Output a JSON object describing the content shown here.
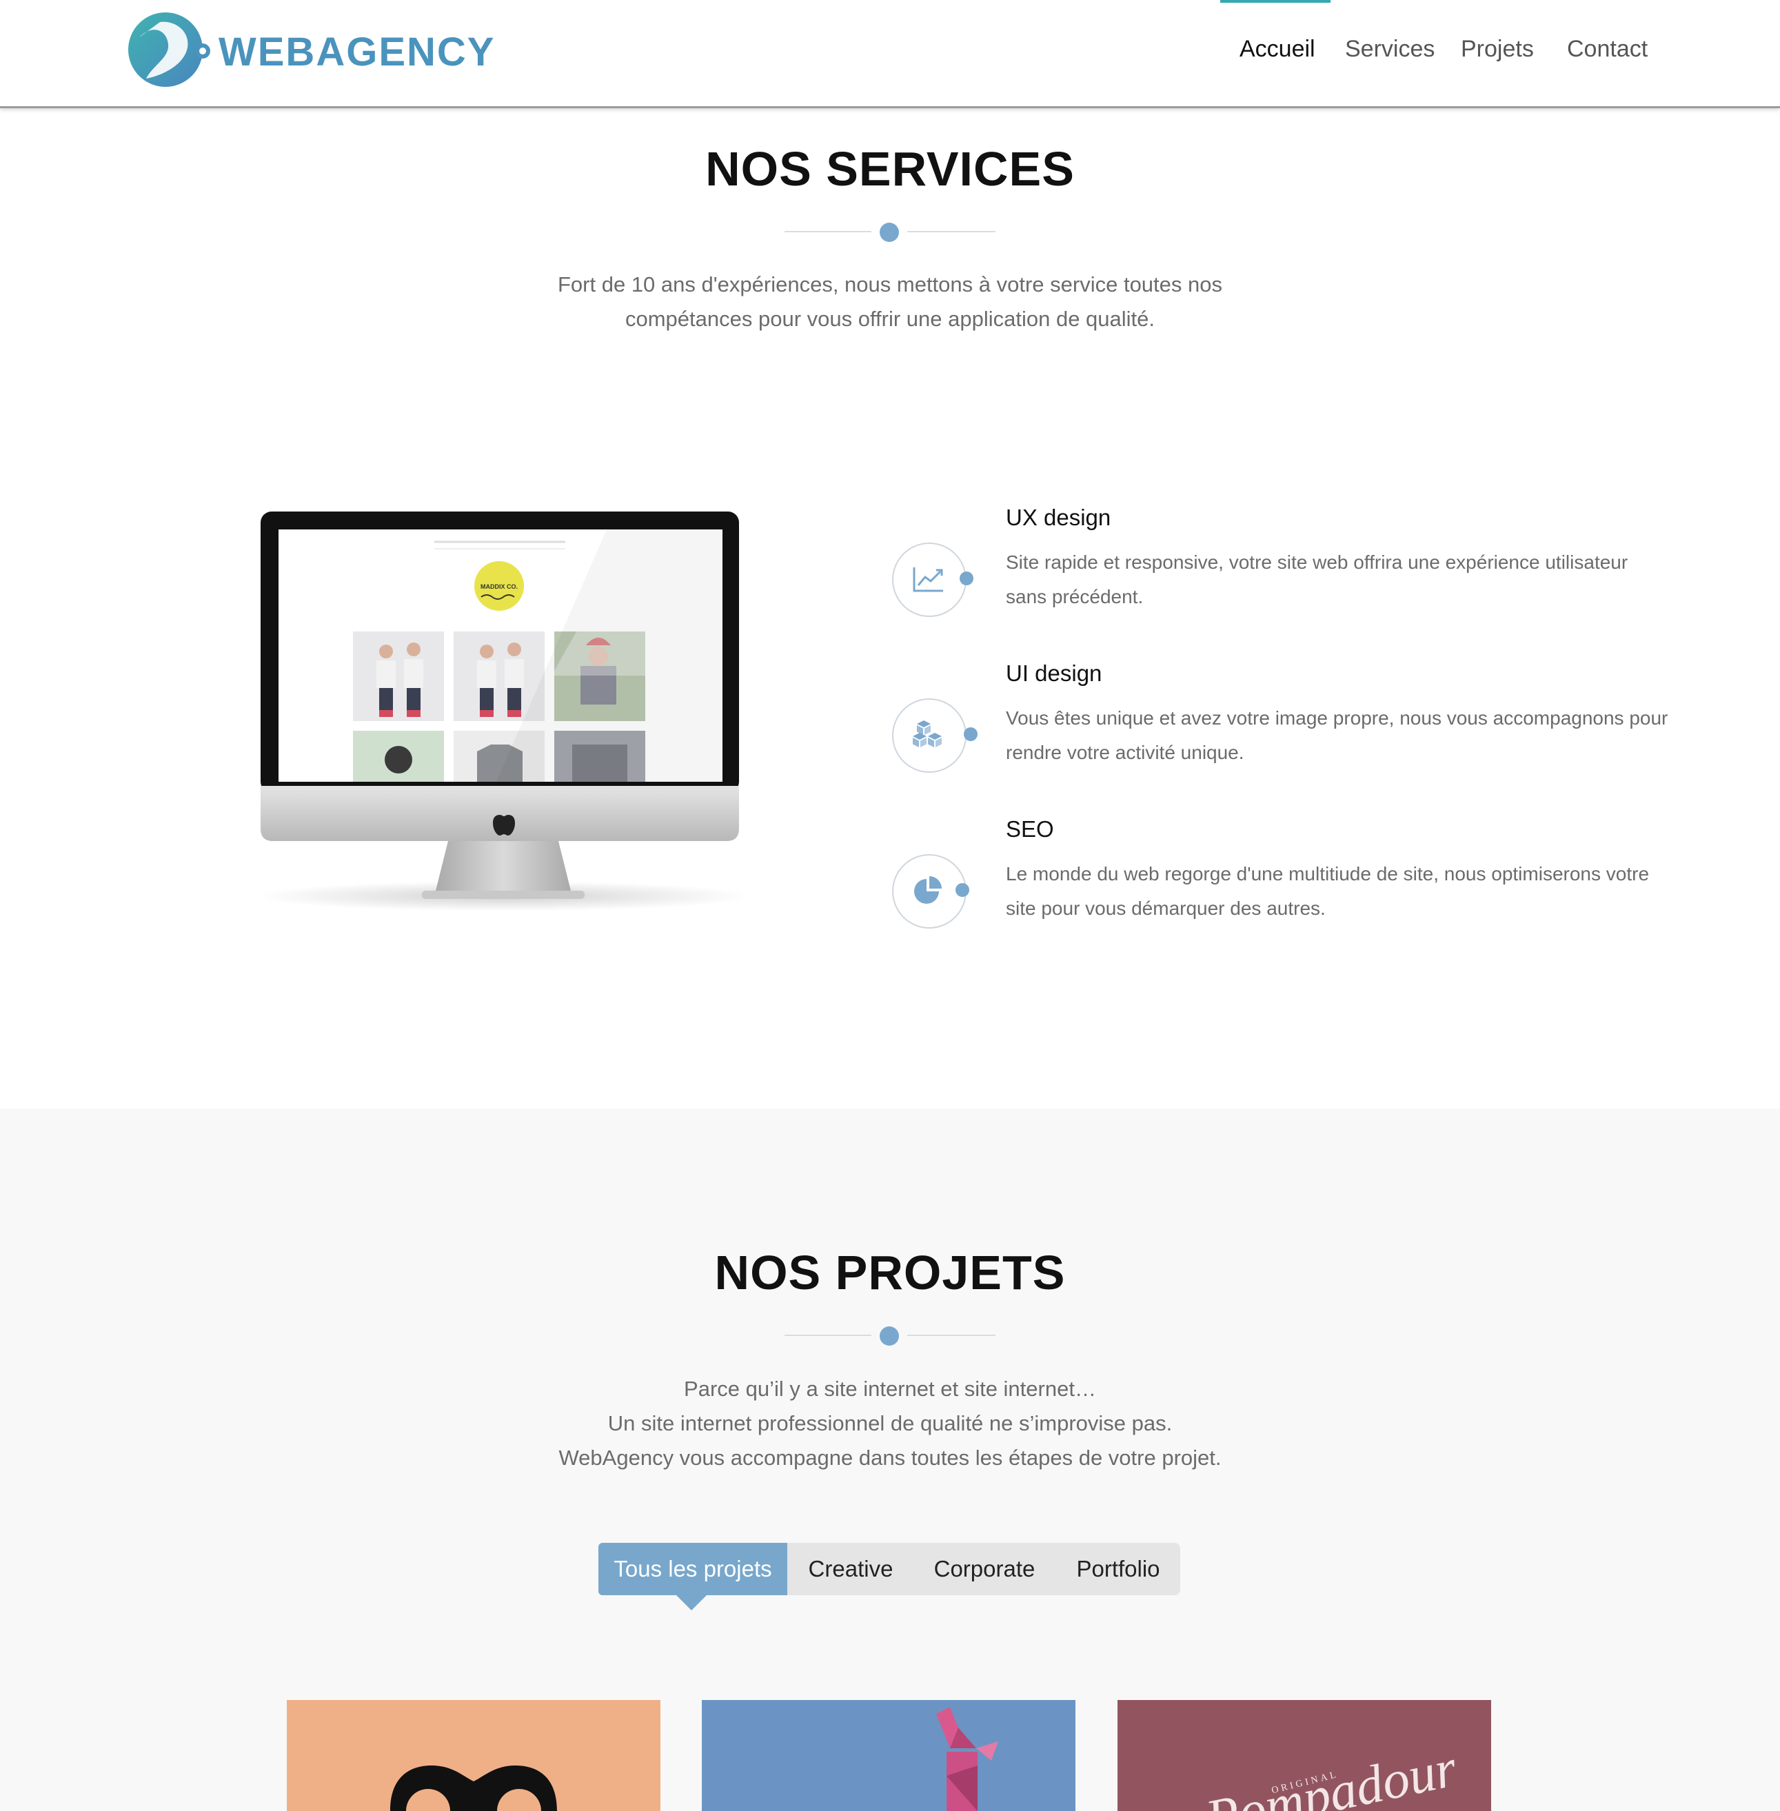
{
  "header": {
    "logo_text": "WEBAGENCY",
    "nav": [
      "Accueil",
      "Services",
      "Projets",
      "Contact"
    ],
    "active_nav": "Accueil"
  },
  "services": {
    "title": "NOS SERVICES",
    "lead_line1": "Fort de 10 ans d'expériences, nous mettons à votre service toutes nos",
    "lead_line2": "compétances pour vous offrir une application de qualité.",
    "items": [
      {
        "title": "UX design",
        "icon": "line-chart-icon",
        "desc_line1": "Site rapide et responsive, votre site web offrira une expérience utilisateur",
        "desc_line2": "sans précédent."
      },
      {
        "title": "UI design",
        "icon": "cubes-icon",
        "desc_line1": "Vous êtes unique et avez votre image propre, nous vous accompagnons pour",
        "desc_line2": "rendre votre activité unique."
      },
      {
        "title": "SEO",
        "icon": "pie-chart-icon",
        "desc_line1": "Le monde du web regorge d'une multitiude de site, nous optimiserons votre",
        "desc_line2": "site pour vous démarquer des autres."
      }
    ],
    "mockup_logo_text": "MADDIX CO."
  },
  "projects": {
    "title": "NOS PROJETS",
    "lead_line1": "Parce qu’il y a site internet et site internet…",
    "lead_line2": "Un site internet professionnel de qualité ne s’improvise pas.",
    "lead_line3": "WebAgency vous accompagne dans toutes les étapes de votre projet.",
    "filters": [
      "Tous les projets",
      "Creative",
      "Corporate",
      "Portfolio"
    ],
    "active_filter": "Tous les projets",
    "cards": [
      {
        "color": "#f0b087",
        "subject": "glasses-illustration"
      },
      {
        "color": "#6b94c4",
        "subject": "origami-rabbit"
      },
      {
        "color": "#92555f",
        "subject": "pompadour-lettering",
        "text_small": "ORIGINAL",
        "text_script": "Pompadour"
      }
    ]
  },
  "colors": {
    "brand": "#4a93bd",
    "accent": "#7aa7cd",
    "nav_indicator": "#35a8b4",
    "section_alt_bg": "#f8f8f8"
  }
}
